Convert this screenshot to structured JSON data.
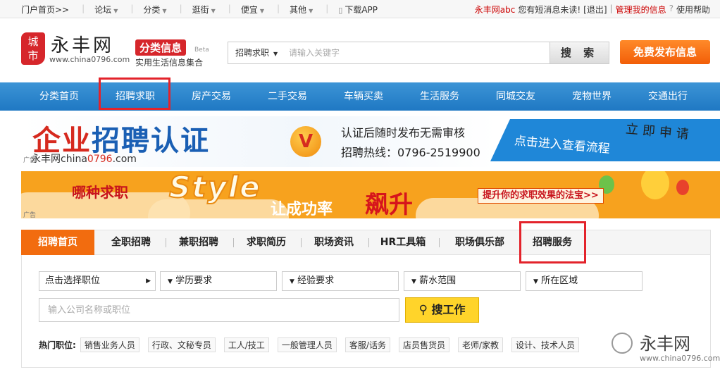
{
  "topbar": {
    "items": [
      {
        "label": "门户首页>>"
      },
      {
        "label": "论坛"
      },
      {
        "label": "分类"
      },
      {
        "label": "逛街"
      },
      {
        "label": "便宜"
      },
      {
        "label": "其他"
      },
      {
        "label": "下载APP"
      }
    ],
    "user": "永丰网abc",
    "msg": "您有短消息未读!",
    "logout": "[退出]",
    "sep": "|",
    "manage": "管理我的信息",
    "help": "使用帮助"
  },
  "logo": {
    "seal_top": "城",
    "seal_bottom": "市",
    "name": "永丰网",
    "url": "www.china0796.com"
  },
  "catlogo": {
    "badge": "分类信息",
    "beta": "Beta",
    "sub": "实用生活信息集合"
  },
  "search": {
    "type": "招聘求职",
    "placeholder": "请输入关键字",
    "button": "搜 索"
  },
  "publish": "免费发布信息",
  "nav": [
    "分类首页",
    "招聘求职",
    "房产交易",
    "二手交易",
    "车辆买卖",
    "生活服务",
    "同城交友",
    "宠物世界",
    "交通出行"
  ],
  "banner1": {
    "title_a": "企业",
    "title_b": "招聘",
    "title_c": "认证",
    "v": "V",
    "line1": "认证后随时发布无需审核",
    "line2": "招聘热线：0796-2519900",
    "link": "点击进入查看流程",
    "apply": "立即申请",
    "wm_a": "永丰网china",
    "wm_b": "0796",
    "wm_c": ".com",
    "ad": "广告"
  },
  "banner2": {
    "q": "哪种求职",
    "style": "Style",
    "s2": "让成功率",
    "s3": "飙升",
    "box": "提升你的求职效果的法宝>>",
    "ad": "广告"
  },
  "tabs": [
    "招聘首页",
    "全职招聘",
    "兼职招聘",
    "求职简历",
    "职场资讯",
    "HR工具箱",
    "职场俱乐部",
    "招聘服务"
  ],
  "filters": {
    "position": "点击选择职位",
    "education": "学历要求",
    "experience": "经验要求",
    "salary": "薪水范围",
    "area": "所在区域",
    "keyword_placeholder": "输入公司名称或职位",
    "find": "搜工作"
  },
  "hot": {
    "label": "热门职位:",
    "tags": [
      "销售业务人员",
      "行政、文秘专员",
      "工人/技工",
      "一般管理人员",
      "客服/话务",
      "店员售货员",
      "老师/家教",
      "设计、技术人员"
    ]
  },
  "wechat": {
    "name": "永丰网",
    "url": "www.china0796.com"
  },
  "colors": {
    "nav_blue": "#1f78c3",
    "orange": "#f26c0f",
    "brand_red": "#d6262b",
    "highlight": "#e3232b",
    "button_yellow": "#ffd42a"
  }
}
